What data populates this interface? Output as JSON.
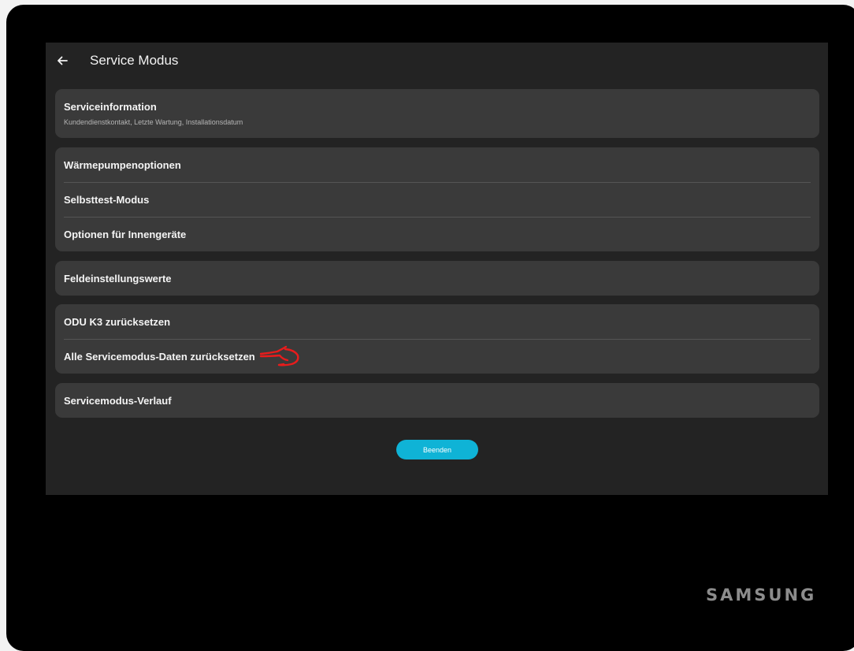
{
  "header": {
    "title": "Service Modus"
  },
  "groups": [
    {
      "items": [
        {
          "label": "Serviceinformation",
          "subtitle": "Kundendienstkontakt, Letzte Wartung, Installationsdatum"
        }
      ]
    },
    {
      "items": [
        {
          "label": "Wärmepumpenoptionen"
        },
        {
          "label": "Selbsttest-Modus"
        },
        {
          "label": "Optionen für Innengeräte"
        }
      ]
    },
    {
      "items": [
        {
          "label": "Feldeinstellungswerte"
        }
      ]
    },
    {
      "items": [
        {
          "label": "ODU K3 zurücksetzen"
        },
        {
          "label": "Alle Servicemodus-Daten zurücksetzen"
        }
      ]
    },
    {
      "items": [
        {
          "label": "Servicemodus-Verlauf"
        }
      ]
    }
  ],
  "actions": {
    "finish_label": "Beenden"
  },
  "brand": {
    "name": "SAMSUNG"
  },
  "colors": {
    "accent": "#0fb3d6",
    "annotation": "#e81c1c",
    "screen_bg": "#232323",
    "card_bg": "#3a3a3a"
  },
  "icons": {
    "back": "back-arrow-icon",
    "annotation": "hand-pointer-icon"
  }
}
